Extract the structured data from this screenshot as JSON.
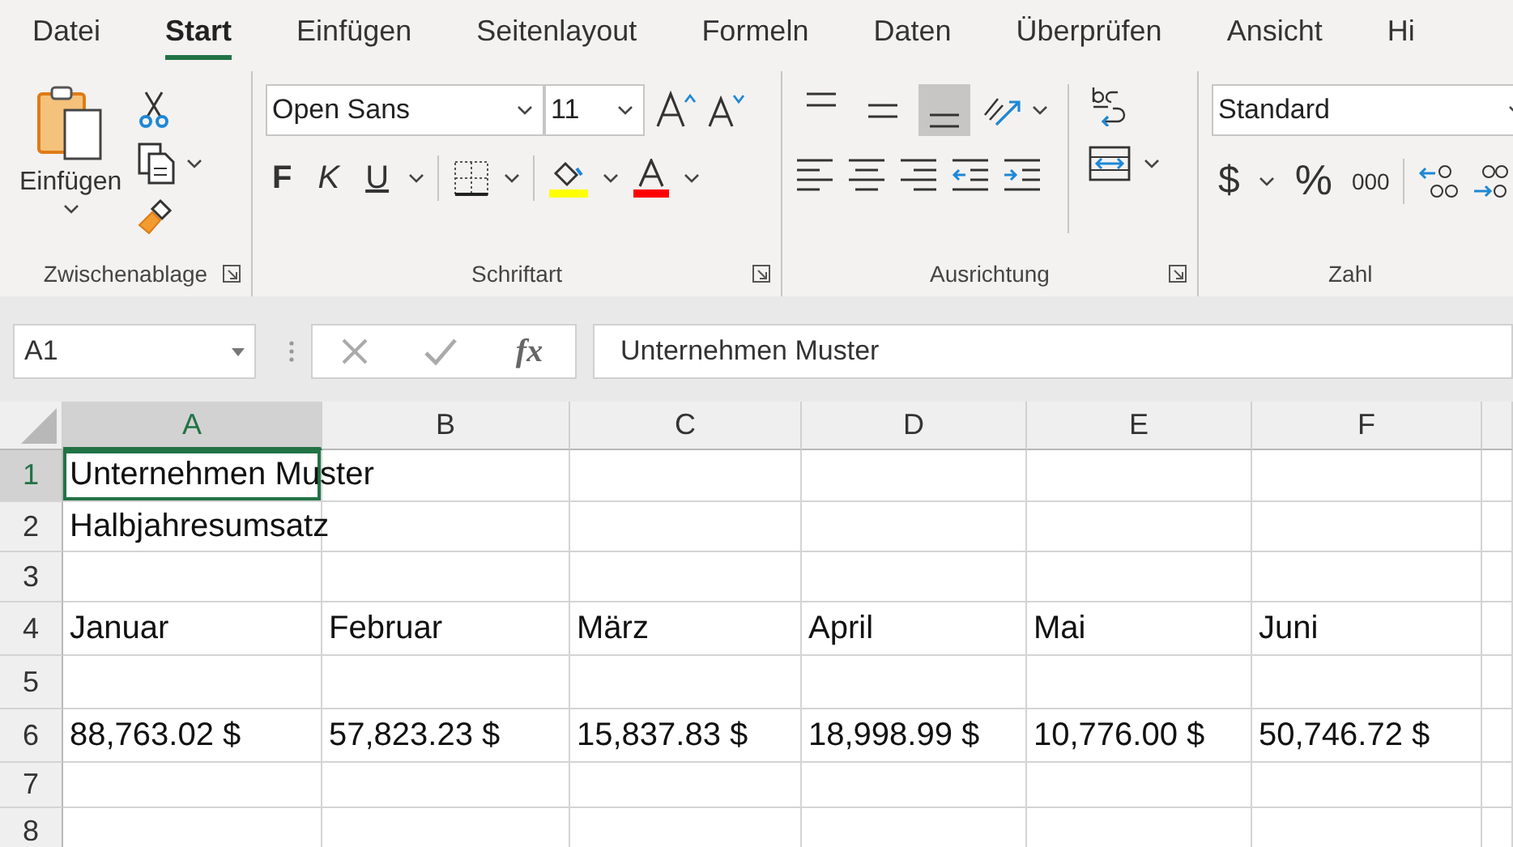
{
  "menu_tabs": [
    {
      "label": "Datei",
      "selected": false
    },
    {
      "label": "Start",
      "selected": true
    },
    {
      "label": "Einfügen",
      "selected": false
    },
    {
      "label": "Seitenlayout",
      "selected": false
    },
    {
      "label": "Formeln",
      "selected": false
    },
    {
      "label": "Daten",
      "selected": false
    },
    {
      "label": "Überprüfen",
      "selected": false
    },
    {
      "label": "Ansicht",
      "selected": false
    },
    {
      "label": "Hi",
      "selected": false
    }
  ],
  "ribbon": {
    "clipboard": {
      "paste_label": "Einfügen",
      "group_label": "Zwischenablage"
    },
    "font": {
      "font_name": "Open Sans",
      "font_size": "11",
      "bold": "F",
      "italic": "K",
      "underline": "U",
      "group_label": "Schriftart"
    },
    "alignment": {
      "vertical": [
        {
          "kind": "top",
          "selected": false
        },
        {
          "kind": "middle",
          "selected": false
        },
        {
          "kind": "bottom",
          "selected": true
        }
      ],
      "group_label": "Ausrichtung"
    },
    "number": {
      "format": "Standard",
      "currency": "$",
      "percent": "%",
      "thousands": "000",
      "group_label": "Zahl"
    }
  },
  "formula_bar": {
    "name_box": "A1",
    "function_label": "fx",
    "formula": "Unternehmen Muster"
  },
  "sheet": {
    "columns": [
      {
        "label": "A",
        "selected": true
      },
      {
        "label": "B",
        "selected": false
      },
      {
        "label": "C",
        "selected": false
      },
      {
        "label": "D",
        "selected": false
      },
      {
        "label": "E",
        "selected": false
      },
      {
        "label": "F",
        "selected": false
      }
    ],
    "rows": [
      {
        "label": "1",
        "selected": true,
        "cells": [
          "Unternehmen Muster"
        ]
      },
      {
        "label": "2",
        "selected": false,
        "cells": [
          "Halbjahresumsatz"
        ]
      },
      {
        "label": "3",
        "selected": false
      },
      {
        "label": "4",
        "selected": false,
        "cells": [
          "Januar",
          "Februar",
          "März",
          "April",
          "Mai",
          "Juni"
        ]
      },
      {
        "label": "5",
        "selected": false
      },
      {
        "label": "6",
        "selected": false,
        "cells": [
          "88,763.02 $",
          "57,823.23 $",
          "15,837.83 $",
          "18,998.99 $",
          "10,776.00 $",
          "50,746.72 $"
        ]
      },
      {
        "label": "7",
        "selected": false
      },
      {
        "label": "8",
        "selected": false
      }
    ]
  }
}
